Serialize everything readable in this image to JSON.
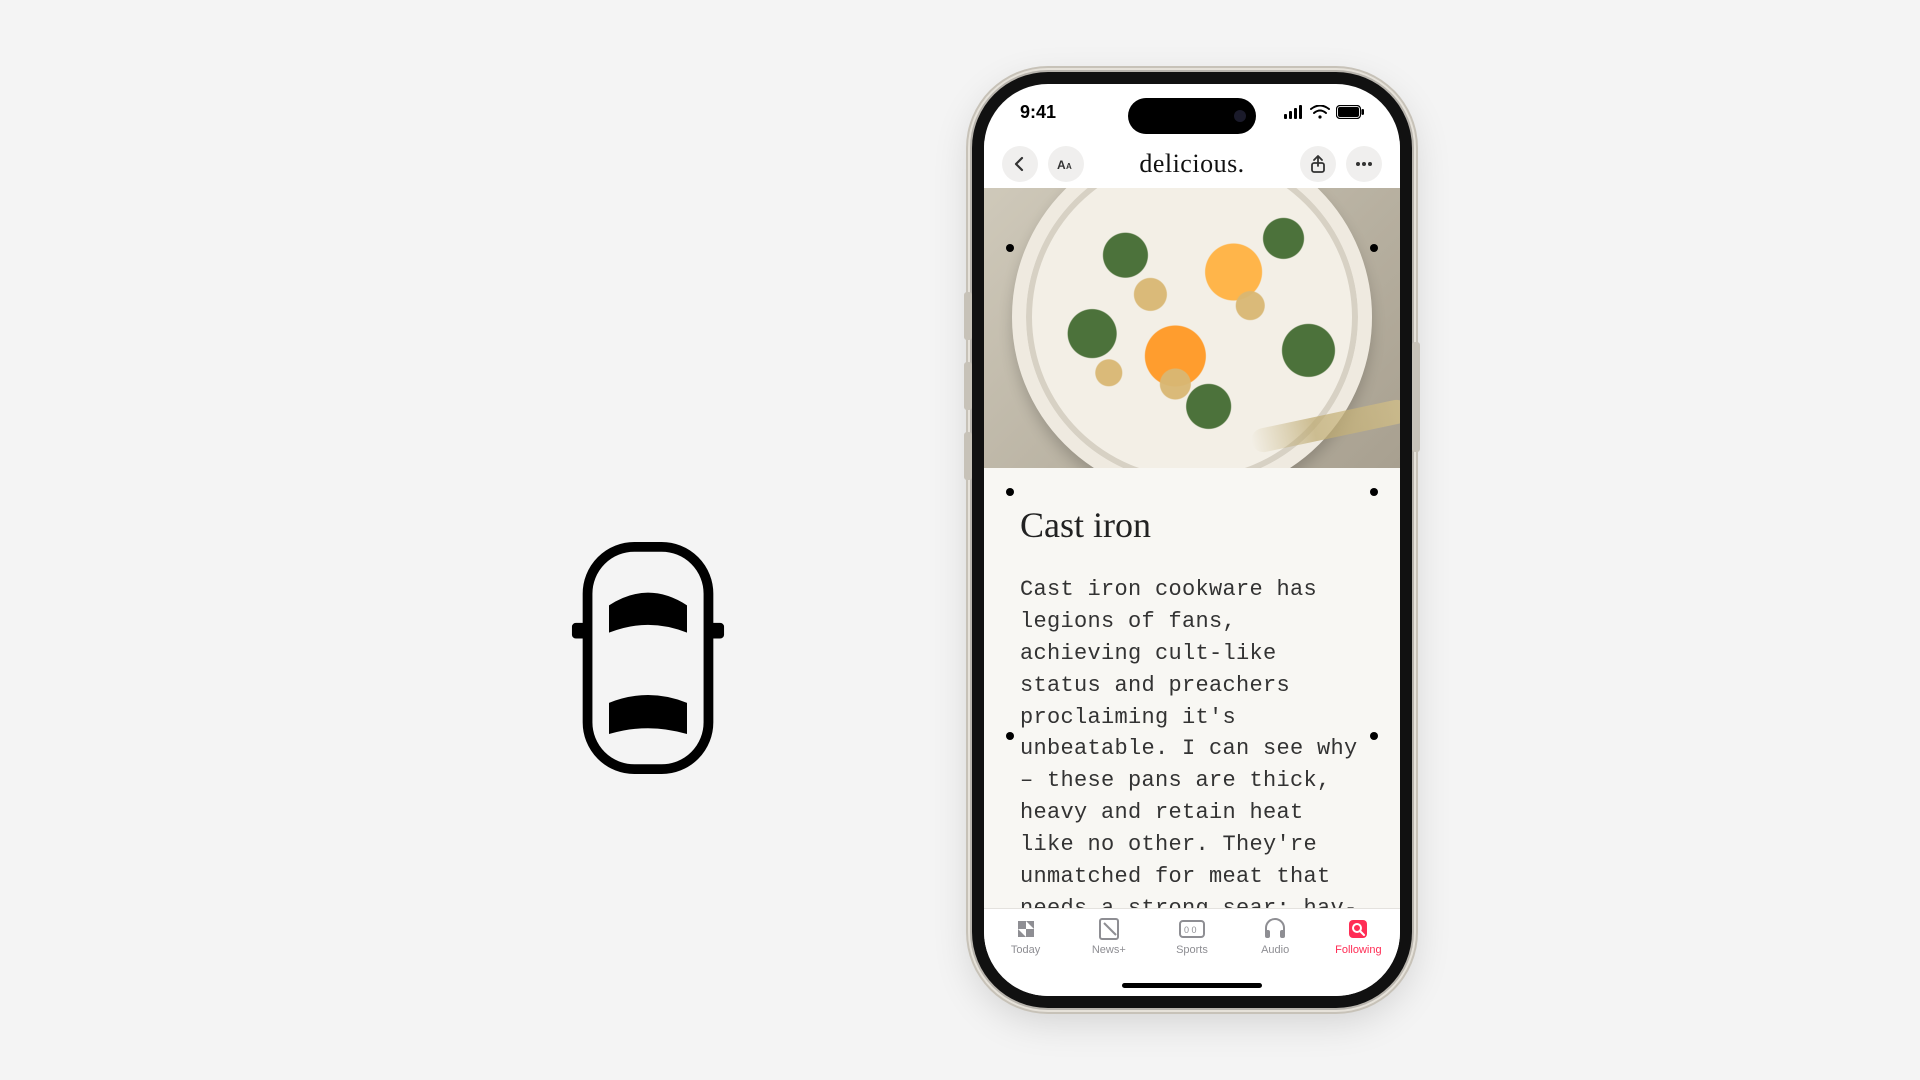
{
  "statusbar": {
    "time": "9:41"
  },
  "navbar": {
    "title": "delicious.",
    "back_icon": "chevron-left",
    "aa_icon": "text-size",
    "share_icon": "share",
    "more_icon": "ellipsis"
  },
  "article": {
    "title": "Cast iron",
    "body": "Cast iron cookware has legions of fans, achieving cult-like status and preachers proclaiming it's unbeatable. I can see why – these pans are thick, heavy and retain heat like no other. They're unmatched for meat that needs a strong sear; hav-"
  },
  "tabs": [
    {
      "label": "Today",
      "icon": "apple-news",
      "active": false
    },
    {
      "label": "News+",
      "icon": "news-plus",
      "active": false
    },
    {
      "label": "Sports",
      "icon": "scoreboard",
      "active": false
    },
    {
      "label": "Audio",
      "icon": "headphones",
      "active": false
    },
    {
      "label": "Following",
      "icon": "search-badge",
      "active": true
    }
  ],
  "colors": {
    "accent": "#ff2d55",
    "muted": "#8e8e93"
  },
  "left_graphic": {
    "name": "car-top-view-icon"
  }
}
